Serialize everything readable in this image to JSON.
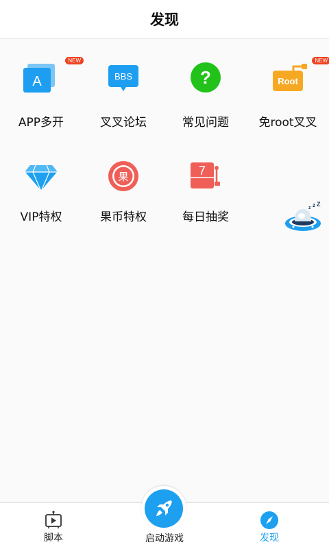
{
  "header": {
    "title": "发现"
  },
  "grid": {
    "items": [
      {
        "label": "APP多开",
        "icon": "app-clone-icon",
        "badge": "NEW"
      },
      {
        "label": "叉叉论坛",
        "icon": "bbs-icon",
        "icon_text": "BBS"
      },
      {
        "label": "常见问题",
        "icon": "question-icon",
        "icon_text": "?"
      },
      {
        "label": "免root叉叉",
        "icon": "root-icon",
        "icon_text": "Root",
        "badge": "NEW"
      },
      {
        "label": "VIP特权",
        "icon": "diamond-icon"
      },
      {
        "label": "果币特权",
        "icon": "coin-icon",
        "icon_text": "果"
      },
      {
        "label": "每日抽奖",
        "icon": "lottery-icon",
        "icon_text": "7"
      }
    ]
  },
  "floating": {
    "icon": "sleeping-ufo-icon"
  },
  "tabbar": {
    "items": [
      {
        "label": "脚本",
        "icon": "script-tv-icon",
        "active": false
      },
      {
        "label": "启动游戏",
        "icon": "rocket-icon",
        "active": false
      },
      {
        "label": "发现",
        "icon": "compass-icon",
        "active": true
      }
    ]
  },
  "colors": {
    "accent": "#1ea0f0",
    "badge": "#f0421f",
    "question_green": "#22c21a",
    "root_orange": "#f7a823",
    "coin_red": "#ef5f57",
    "lottery_red": "#ef5f57"
  }
}
